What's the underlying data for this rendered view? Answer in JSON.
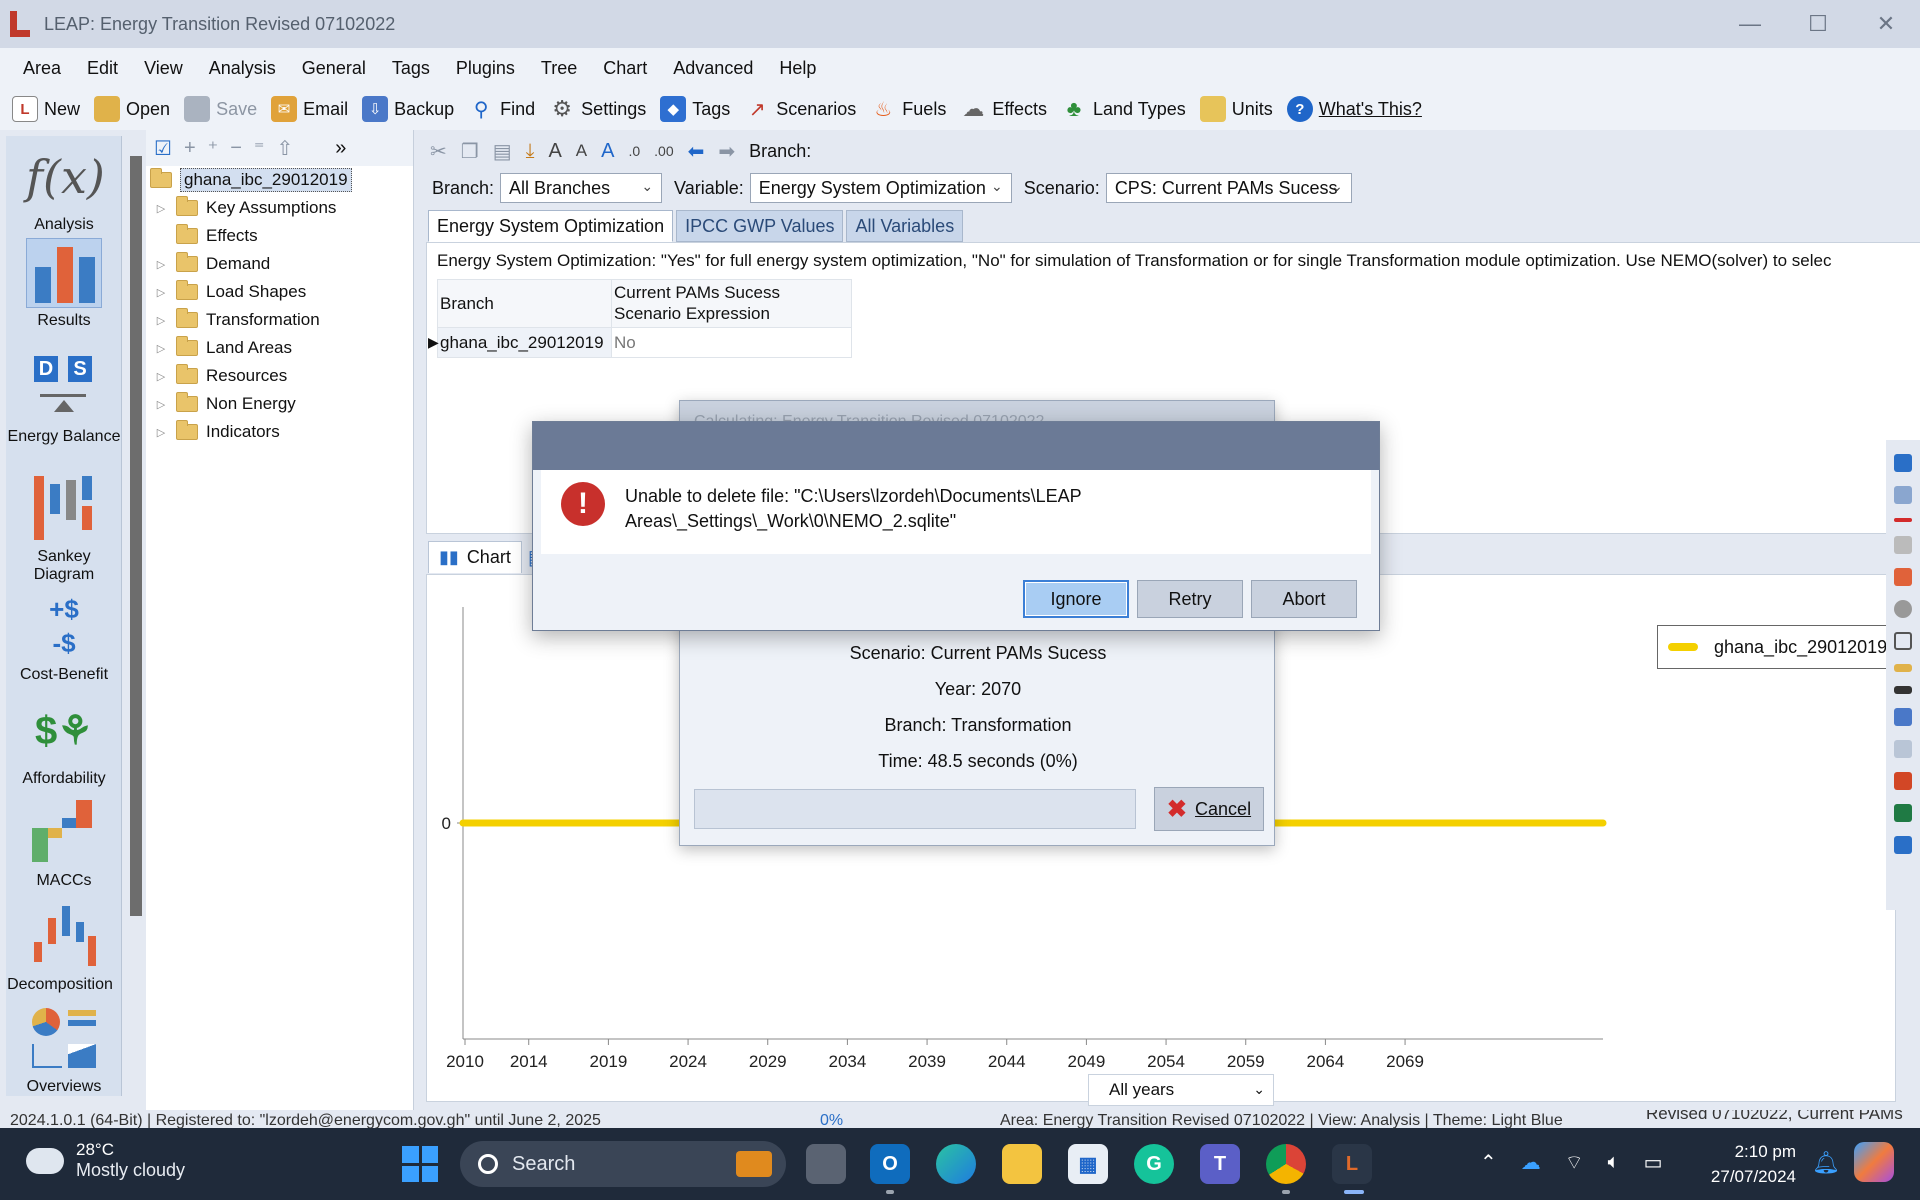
{
  "window": {
    "title": "LEAP: Energy Transition Revised 07102022"
  },
  "menu": [
    "Area",
    "Edit",
    "View",
    "Analysis",
    "General",
    "Tags",
    "Plugins",
    "Tree",
    "Chart",
    "Advanced",
    "Help"
  ],
  "toolbar": {
    "new": "New",
    "open": "Open",
    "save": "Save",
    "email": "Email",
    "backup": "Backup",
    "find": "Find",
    "settings": "Settings",
    "tags": "Tags",
    "scenarios": "Scenarios",
    "fuels": "Fuels",
    "effects": "Effects",
    "land_types": "Land Types",
    "units": "Units",
    "whats_this": "What's This?"
  },
  "sidebar": {
    "analysis": "Analysis",
    "results": "Results",
    "energy_balance": "Energy Balance",
    "sankey": "Sankey Diagram",
    "cost_benefit": "Cost-Benefit",
    "affordability": "Affordability",
    "maccs": "MACCs",
    "decomposition": "Decomposition",
    "overviews": "Overviews"
  },
  "tree": {
    "root": "ghana_ibc_29012019",
    "items": [
      "Key Assumptions",
      "Effects",
      "Demand",
      "Load Shapes",
      "Transformation",
      "Land Areas",
      "Resources",
      "Non Energy",
      "Indicators"
    ]
  },
  "main": {
    "branch_label": "Branch:",
    "filters": {
      "branch_label": "Branch:",
      "branch_value": "All Branches",
      "variable_label": "Variable:",
      "variable_value": "Energy System Optimization",
      "scenario_label": "Scenario:",
      "scenario_value": "CPS: Current PAMs Sucess"
    },
    "tabs": [
      "Energy System Optimization",
      "IPCC GWP Values",
      "All Variables"
    ],
    "info_text": "Energy System Optimization: \"Yes\" for full energy system optimization, \"No\" for simulation of Transformation or for single Transformation module optimization.  Use NEMO(solver) to selec",
    "grid": {
      "col_branch": "Branch",
      "col_expr": "Current PAMs Sucess Scenario Expression",
      "row_branch": "ghana_ibc_29012019",
      "row_value": "No"
    },
    "chart_tab": "Chart",
    "legend": "ghana_ibc_29012019",
    "years_select": "All years"
  },
  "chart_data": {
    "type": "line",
    "x": [
      2010,
      2014,
      2019,
      2024,
      2029,
      2034,
      2039,
      2044,
      2049,
      2054,
      2059,
      2064,
      2069
    ],
    "series": [
      {
        "name": "ghana_ibc_29012019",
        "values": [
          0,
          0,
          0,
          0,
          0,
          0,
          0,
          0,
          0,
          0,
          0,
          0,
          0
        ]
      }
    ],
    "y_ticks": [
      "0"
    ],
    "xlim": [
      2010,
      2070
    ],
    "color": "#f4d000",
    "grid": false,
    "legend_position": "top-right"
  },
  "progress_dialog": {
    "title": "Calculating: Energy Transition Revised 07102022",
    "scenario": "Scenario: Current PAMs Sucess",
    "year": "Year: 2070",
    "branch": "Branch: Transformation",
    "time": "Time: 48.5 seconds (0%)",
    "cancel": "Cancel"
  },
  "error_dialog": {
    "message": "Unable to delete file: \"C:\\Users\\lzordeh\\Documents\\LEAP Areas\\_Settings\\_Work\\0\\NEMO_2.sqlite\"",
    "ignore": "Ignore",
    "retry": "Retry",
    "abort": "Abort"
  },
  "statusbar": {
    "left": "2024.1.0.1 (64-Bit)  |  Registered to: \"lzordeh@energycom.gov.gh\" until June 2, 2025",
    "mid": "0%",
    "area": "Area: Energy Transition Revised 07102022  |  View: Analysis  |  Theme: Light Blue",
    "right": "Revised 07102022, Current PAMs"
  },
  "taskbar": {
    "temp": "28°C",
    "weather": "Mostly cloudy",
    "search": "Search",
    "time": "2:10 pm",
    "date": "27/07/2024"
  }
}
